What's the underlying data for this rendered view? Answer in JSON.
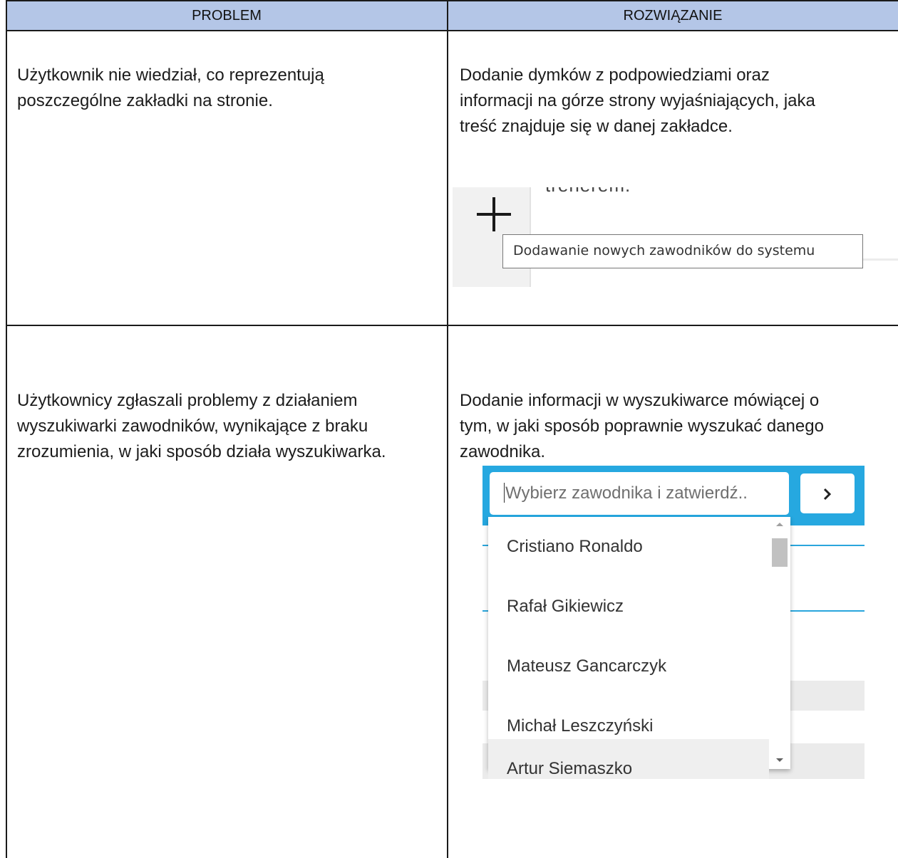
{
  "table": {
    "headers": {
      "problem": "PROBLEM",
      "solution": "ROZWIĄZANIE"
    },
    "rows": [
      {
        "problem_lines": [
          "Użytkownik nie wiedział, co reprezentują",
          "poszczególne zakładki na stronie."
        ],
        "solution_lines": [
          "Dodanie dymków z podpowiedziami oraz",
          "informacji na górze strony wyjaśniających, jaka",
          "treść znajduje się w danej zakładce."
        ]
      },
      {
        "problem_lines": [
          "Użytkownicy zgłaszali problemy z działaniem",
          "wyszukiwarki zawodników, wynikające z braku",
          "zrozumienia, w jaki sposób działa wyszukiwarka."
        ],
        "solution_lines": [
          "Dodanie informacji w wyszukiwarce mówiącej o",
          "tym, w jaki sposób poprawnie wyszukać danego",
          "zawodnika."
        ]
      }
    ]
  },
  "tooltip_screenshot": {
    "icon": "plus-icon",
    "cut_text": "trenerem.",
    "tooltip_text": "Dodawanie nowych zawodników do systemu"
  },
  "search_screenshot": {
    "placeholder": "Wybierz zawodnika i zatwierdź..",
    "button_icon": "chevron-right-icon",
    "options": [
      "Cristiano Ronaldo",
      "Rafał Gikiewicz",
      "Mateusz Gancarczyk",
      "Michał Leszczyński",
      "Artur Siemaszko"
    ],
    "highlighted_option": "Artur Siemaszko",
    "colors": {
      "header_bar": "#26a8e0",
      "table_header": "#b4c6e7"
    }
  }
}
